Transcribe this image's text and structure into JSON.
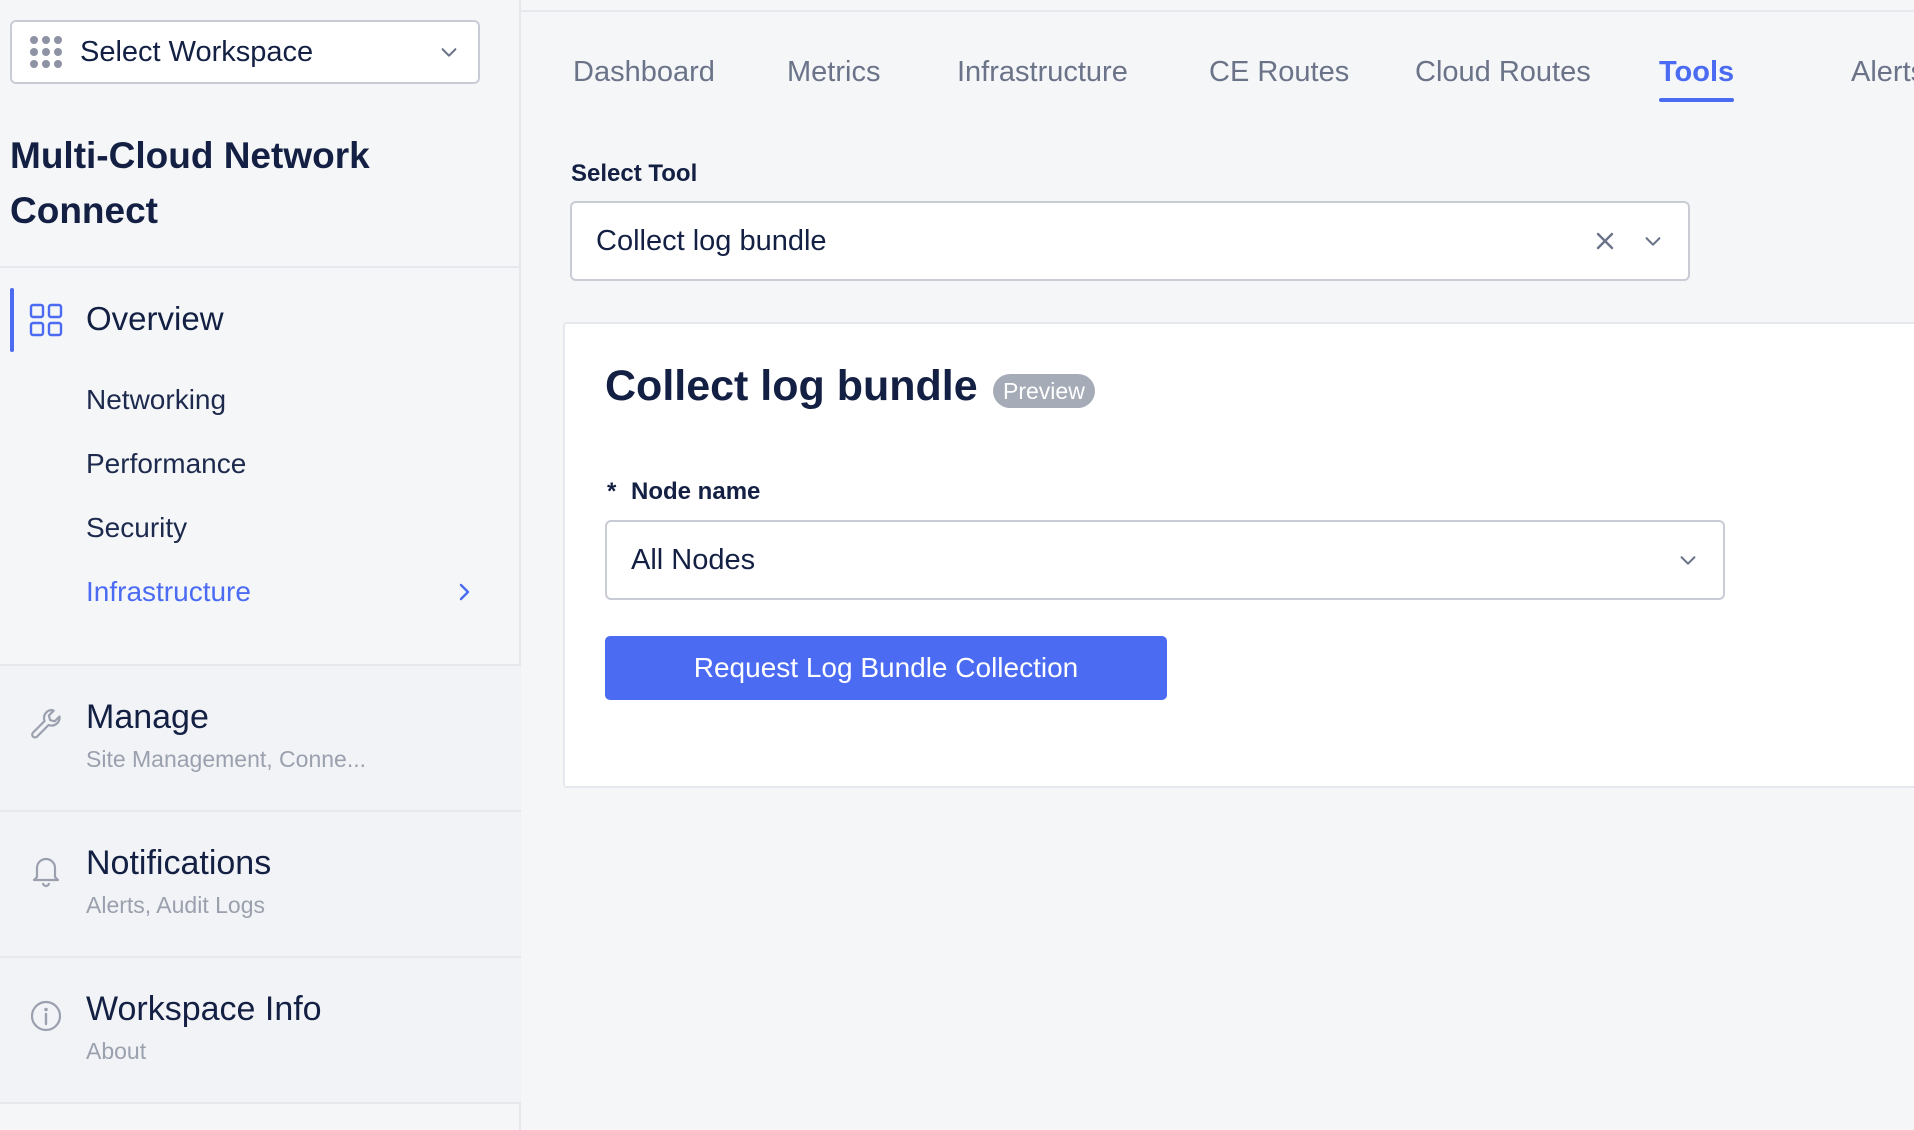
{
  "workspace": {
    "label": "Select Workspace",
    "icon": "grid-dots-icon"
  },
  "app": {
    "title": "Multi-Cloud Network Connect"
  },
  "sidebar": {
    "overview": {
      "label": "Overview",
      "icon": "dashboard-grid-icon"
    },
    "subnav": [
      {
        "label": "Networking"
      },
      {
        "label": "Performance"
      },
      {
        "label": "Security"
      },
      {
        "label": "Infrastructure",
        "active": true
      }
    ],
    "sections": [
      {
        "title": "Manage",
        "subtitle": "Site Management, Conne...",
        "icon": "wrench-icon"
      },
      {
        "title": "Notifications",
        "subtitle": "Alerts, Audit Logs",
        "icon": "bell-icon"
      },
      {
        "title": "Workspace Info",
        "subtitle": "About",
        "icon": "info-icon"
      }
    ]
  },
  "tabs": [
    {
      "label": "Dashboard"
    },
    {
      "label": "Metrics"
    },
    {
      "label": "Infrastructure"
    },
    {
      "label": "CE Routes"
    },
    {
      "label": "Cloud Routes"
    },
    {
      "label": "Tools",
      "active": true
    },
    {
      "label": "Alerts"
    }
  ],
  "select_tool": {
    "label": "Select Tool",
    "value": "Collect log bundle"
  },
  "card": {
    "title": "Collect log bundle",
    "badge": "Preview",
    "node_field": {
      "required_mark": "*",
      "label": "Node name",
      "value": "All Nodes"
    },
    "button": "Request Log Bundle Collection"
  },
  "colors": {
    "accent": "#4a6bf2",
    "text": "#132043",
    "muted": "#6b7389",
    "badge": "#a6abb8"
  }
}
